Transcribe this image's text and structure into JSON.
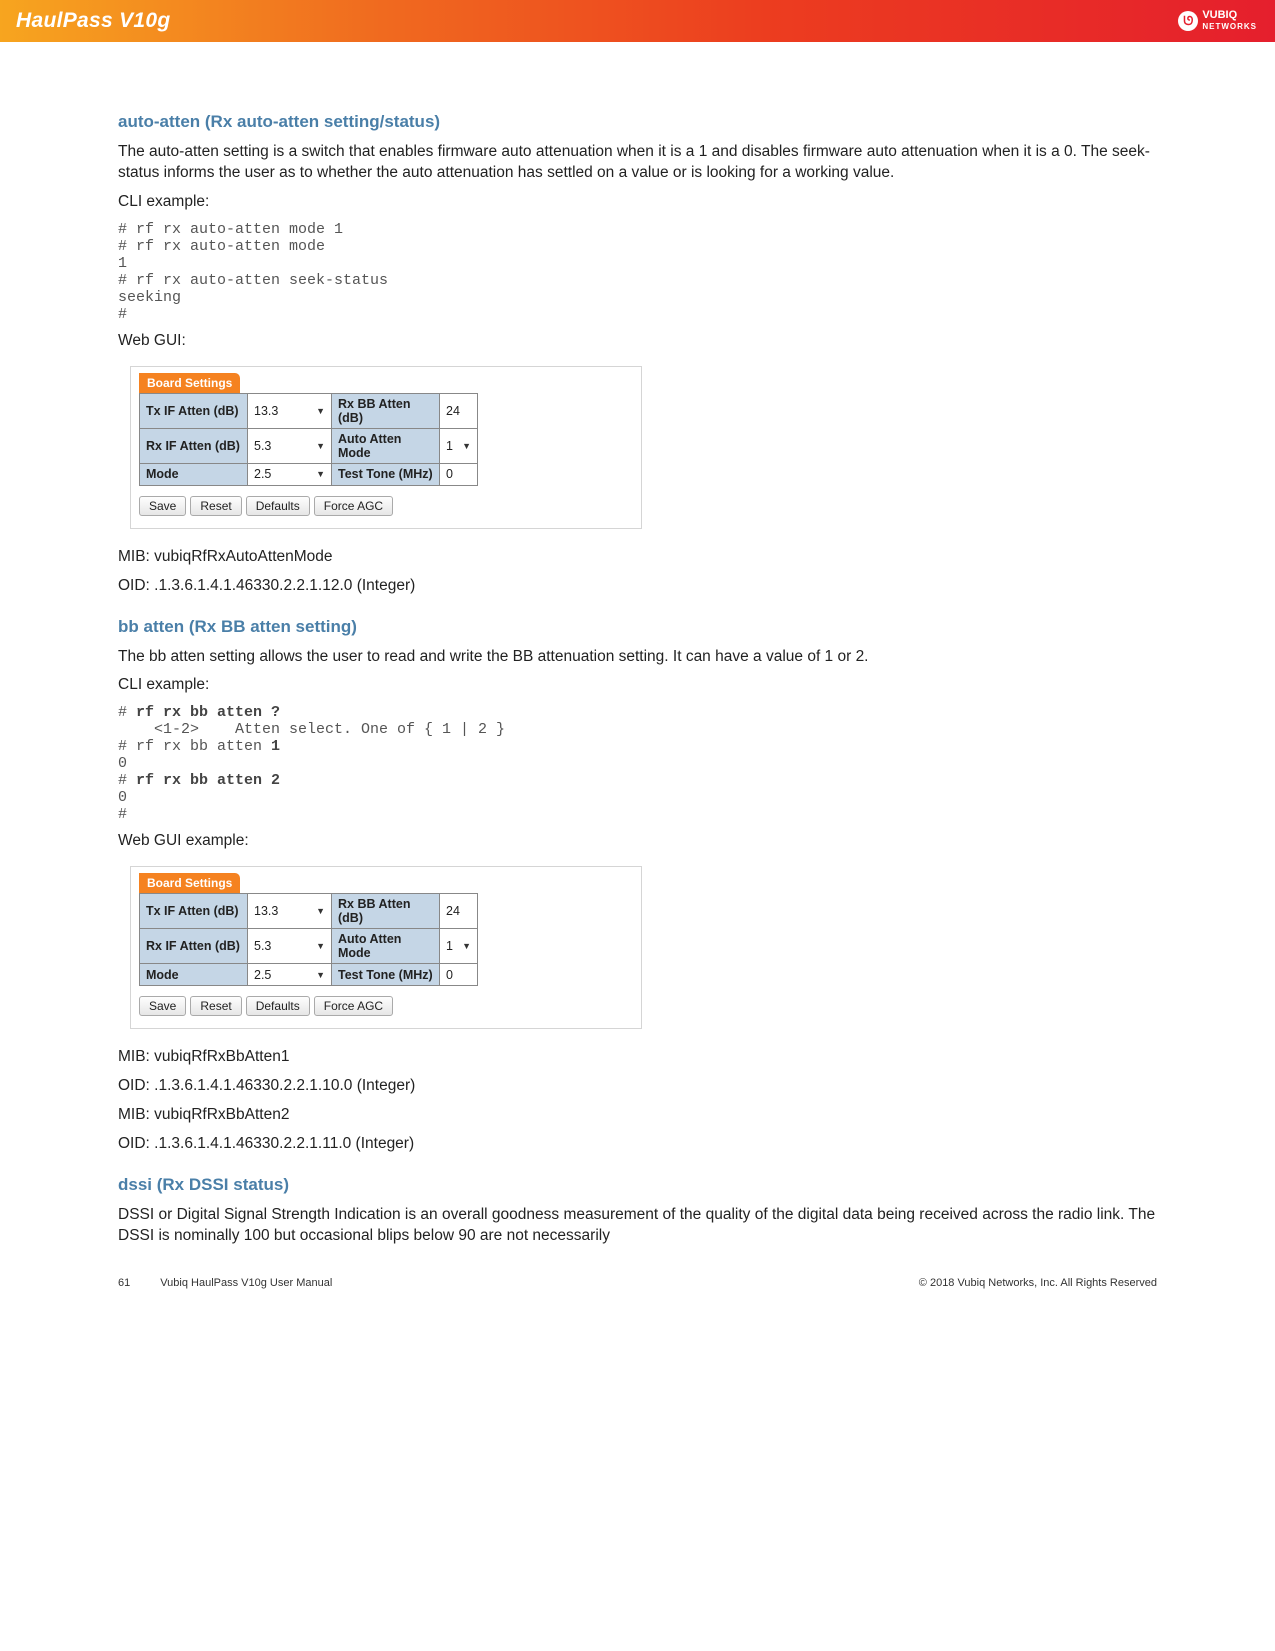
{
  "header": {
    "product": "HaulPass V10g",
    "logo_glyph": "ᘎ",
    "brand_top": "VUBIQ",
    "brand_bottom": "NETWORKS"
  },
  "section1": {
    "heading": "auto-atten (Rx auto-atten setting/status)",
    "body": "The auto-atten setting is a switch that enables firmware auto attenuation when it is a 1 and disables firmware auto attenuation when it is a 0.  The seek-status informs the user as to whether the auto attenuation has settled on a value or is looking for a working value.",
    "cli_label": "CLI example:",
    "cli": "# rf rx auto-atten mode 1\n# rf rx auto-atten mode\n1\n# rf rx auto-atten seek-status\nseeking\n#",
    "webgui_label": "Web GUI:",
    "mib": "MIB: vubiqRfRxAutoAttenMode",
    "oid": "OID: .1.3.6.1.4.1.46330.2.2.1.12.0 (Integer)"
  },
  "section2": {
    "heading": "bb atten (Rx BB atten setting)",
    "body": "The bb atten setting allows the user to read and write the BB attenuation setting.  It can have a value of 1 or 2.",
    "cli_label": "CLI example:",
    "cli_l1": "# ",
    "cli_l1b": "rf rx bb atten ?",
    "cli_l2": "    <1-2>    Atten select. One of { 1 | 2 }",
    "cli_l3": "# rf rx bb atten ",
    "cli_l3b": "1",
    "cli_l4": "0",
    "cli_l5": "# ",
    "cli_l5b": "rf rx bb atten 2",
    "cli_l6": "0",
    "cli_l7": "#",
    "webgui_label": "Web GUI example:",
    "mib1": "MIB: vubiqRfRxBbAtten1",
    "oid1": "OID: .1.3.6.1.4.1.46330.2.2.1.10.0 (Integer)",
    "mib2": "MIB: vubiqRfRxBbAtten2",
    "oid2": "OID: .1.3.6.1.4.1.46330.2.2.1.11.0 (Integer)"
  },
  "section3": {
    "heading": "dssi (Rx DSSI status)",
    "body": "DSSI or Digital Signal Strength Indication is an overall goodness measurement of the quality of the digital data being received across the radio link.  The DSSI is nominally 100 but occasional blips below 90 are not necessarily"
  },
  "gui": {
    "tab": "Board Settings",
    "rows": [
      {
        "l": "Tx IF Atten (dB)",
        "v": "13.3",
        "r": "Rx BB Atten (dB)",
        "rv": "24",
        "ldrop": true,
        "rdrop": false
      },
      {
        "l": "Rx IF Atten (dB)",
        "v": "5.3",
        "r": "Auto Atten Mode",
        "rv": "1",
        "ldrop": true,
        "rdrop": true
      },
      {
        "l": "Mode",
        "v": "2.5",
        "r": "Test Tone (MHz)",
        "rv": "0",
        "ldrop": true,
        "rdrop": false
      }
    ],
    "buttons": [
      "Save",
      "Reset",
      "Defaults",
      "Force AGC"
    ]
  },
  "footer": {
    "page": "61",
    "doc": "Vubiq HaulPass V10g User Manual",
    "copyright": "© 2018 Vubiq Networks, Inc. All Rights Reserved"
  }
}
